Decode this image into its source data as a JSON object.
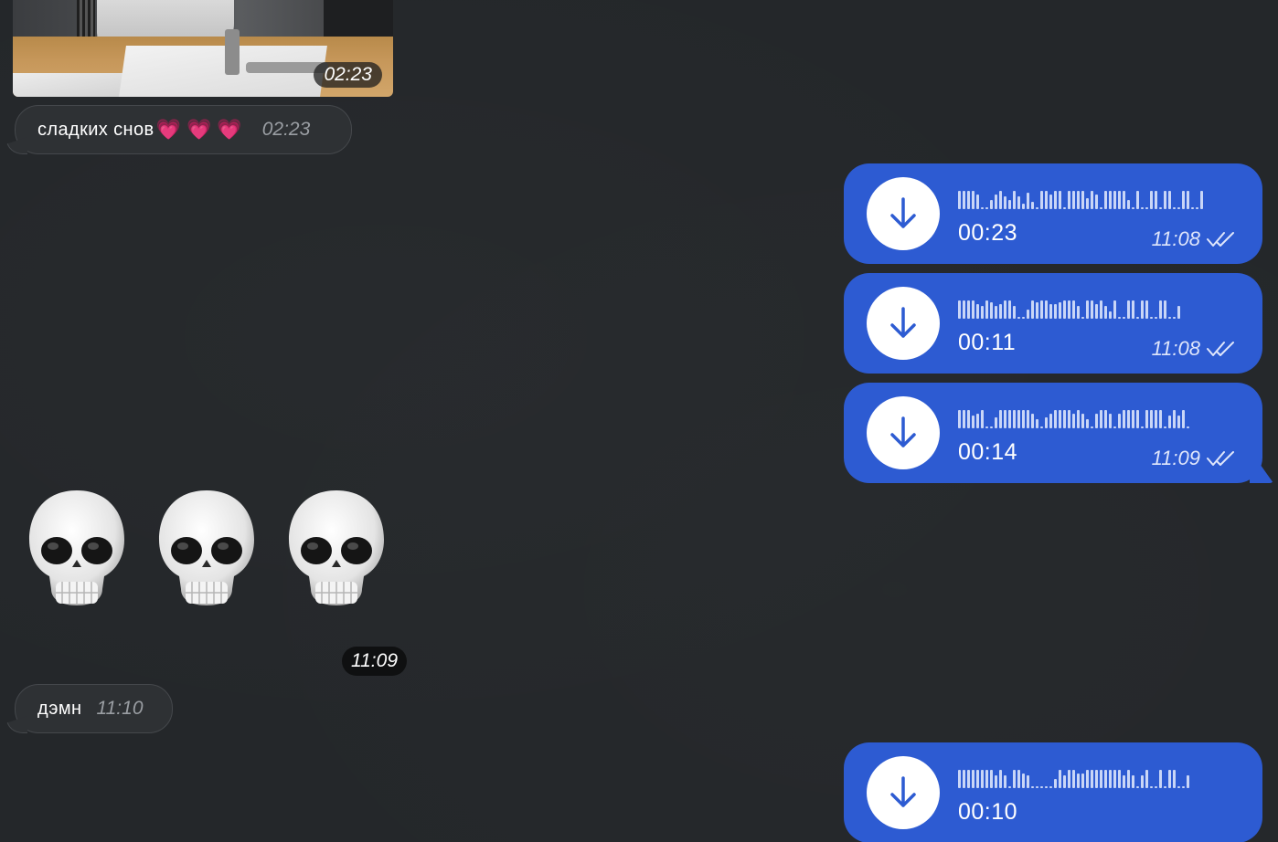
{
  "colors": {
    "background": "#24272a",
    "incoming_bubble": "#2e3134",
    "outgoing_bubble": "#2d5bd2",
    "heart": "#ee5fa8"
  },
  "photo_message": {
    "time": "02:23"
  },
  "incoming_messages": [
    {
      "text": "сладких снов",
      "emoji": "💗💗💗",
      "time": "02:23"
    },
    {
      "text": "дэмн",
      "time": "11:10"
    }
  ],
  "emoji_message": {
    "emoji": [
      "skull",
      "skull",
      "skull"
    ],
    "time": "11:09"
  },
  "voice_messages": [
    {
      "duration": "00:23",
      "time": "11:08",
      "status_icon": "double-check-icon",
      "wave": [
        20,
        20,
        20,
        20,
        16,
        2,
        2,
        10,
        16,
        20,
        14,
        10,
        20,
        14,
        6,
        18,
        8,
        2,
        20,
        20,
        16,
        20,
        20,
        2,
        20,
        20,
        20,
        20,
        12,
        20,
        16,
        2,
        20,
        20,
        20,
        20,
        20,
        10,
        2,
        20,
        2,
        2,
        20,
        20,
        2,
        20,
        20,
        2,
        2,
        20,
        20,
        2,
        2,
        20
      ]
    },
    {
      "duration": "00:11",
      "time": "11:08",
      "status_icon": "double-check-icon",
      "wave": [
        20,
        20,
        20,
        20,
        16,
        14,
        20,
        18,
        14,
        16,
        20,
        20,
        14,
        2,
        2,
        10,
        20,
        18,
        20,
        20,
        16,
        16,
        18,
        20,
        20,
        20,
        14,
        2,
        20,
        20,
        16,
        20,
        14,
        8,
        20,
        2,
        2,
        20,
        20,
        2,
        20,
        20,
        2,
        2,
        20,
        20,
        2,
        2,
        14
      ]
    },
    {
      "duration": "00:14",
      "time": "11:09",
      "status_icon": "double-check-icon",
      "wave": [
        20,
        20,
        20,
        14,
        16,
        20,
        2,
        2,
        12,
        20,
        20,
        20,
        20,
        20,
        20,
        20,
        16,
        10,
        2,
        12,
        16,
        20,
        20,
        20,
        20,
        16,
        20,
        16,
        10,
        2,
        16,
        20,
        20,
        16,
        2,
        16,
        20,
        20,
        20,
        20,
        2,
        20,
        20,
        20,
        20,
        2,
        14,
        20,
        14,
        20,
        2
      ]
    },
    {
      "duration": "00:10",
      "time": "",
      "status_icon": "",
      "wave": [
        20,
        20,
        20,
        20,
        20,
        20,
        20,
        20,
        14,
        20,
        14,
        2,
        20,
        20,
        16,
        14,
        2,
        2,
        2,
        2,
        2,
        10,
        20,
        14,
        20,
        20,
        16,
        16,
        20,
        20,
        20,
        20,
        20,
        20,
        20,
        20,
        14,
        20,
        14,
        2,
        14,
        20,
        2,
        2,
        20,
        2,
        20,
        20,
        2,
        2,
        14
      ]
    }
  ]
}
